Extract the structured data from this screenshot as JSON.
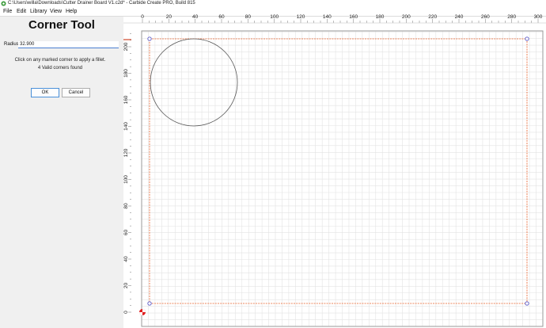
{
  "window": {
    "title": "C:\\Users\\willa\\Downloads\\Cutter Drainer Board V1.c2d* - Carbide Create PRO, Build 815"
  },
  "menu": {
    "file": "File",
    "edit": "Edit",
    "library": "Library",
    "view": "View",
    "help": "Help"
  },
  "panel": {
    "title": "Corner Tool",
    "radius_label": "Radius",
    "radius_value": "32.900",
    "instruction": "Click on any marked corner to apply a fillet.",
    "status": "4 Valid corners found",
    "ok_label": "OK",
    "cancel_label": "Cancel"
  },
  "rulers": {
    "x_ticks": [
      "0",
      "20",
      "40",
      "60",
      "80",
      "100",
      "120",
      "140",
      "160",
      "180",
      "200",
      "220",
      "240",
      "260",
      "280",
      "300"
    ],
    "y_ticks": [
      "0",
      "20",
      "40",
      "60",
      "80",
      "100",
      "120",
      "140",
      "160",
      "180",
      "200"
    ]
  },
  "colors": {
    "grid": "#e3e3e3",
    "stock_outline": "#9a9a9a",
    "toolpath": "#e8602a",
    "corner_marker": "#5a5ac8",
    "circle": "#555555",
    "origin": "#e02020"
  },
  "icons": {
    "app": "carbide-create-icon",
    "origin": "origin-marker-icon",
    "corner": "corner-marker-icon"
  }
}
